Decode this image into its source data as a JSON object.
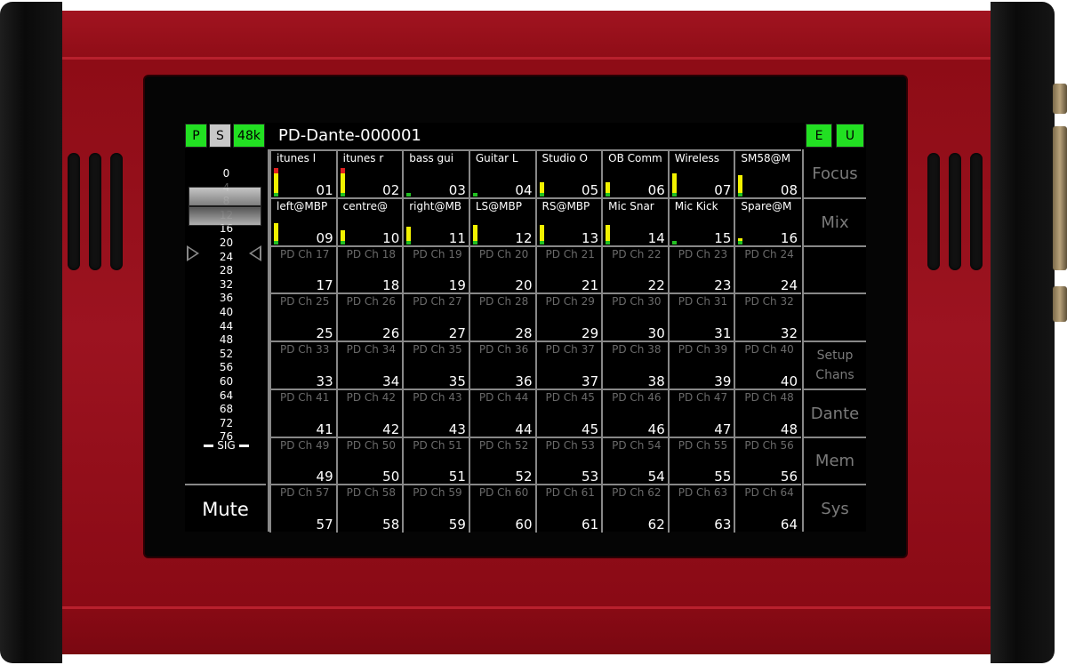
{
  "header": {
    "status": [
      {
        "label": "P",
        "on": true
      },
      {
        "label": "S",
        "on": false
      },
      {
        "label": "48k",
        "on": true
      }
    ],
    "device_name": "PD-Dante-000001",
    "modes": [
      {
        "label": "E",
        "on": true
      },
      {
        "label": "U",
        "on": true
      }
    ]
  },
  "level_scale": [
    "0",
    "4",
    "8",
    "12",
    "16",
    "20",
    "24",
    "28",
    "32",
    "36",
    "40",
    "44",
    "48",
    "52",
    "56",
    "60",
    "64",
    "68",
    "72",
    "76"
  ],
  "sig_label": "SIG",
  "mute_label": "Mute",
  "side_buttons": [
    {
      "label": "Focus"
    },
    {
      "label": "Mix"
    },
    {
      "label": ""
    },
    {
      "label": ""
    },
    {
      "label": "Setup Chans",
      "line1": "Setup",
      "line2": "Chans"
    },
    {
      "label": "Dante"
    },
    {
      "label": "Mem"
    },
    {
      "label": "Sys"
    }
  ],
  "channels": [
    {
      "name": "itunes l",
      "num": "01",
      "meter": {
        "green": 0.1,
        "yellow": 0.55,
        "red": 0.15
      }
    },
    {
      "name": "itunes r",
      "num": "02",
      "meter": {
        "green": 0.1,
        "yellow": 0.55,
        "red": 0.15
      }
    },
    {
      "name": "bass gui",
      "num": "03",
      "meter": {
        "green": 0.1,
        "yellow": 0,
        "red": 0
      }
    },
    {
      "name": "Guitar L",
      "num": "04",
      "meter": {
        "green": 0.1,
        "yellow": 0,
        "red": 0
      }
    },
    {
      "name": "Studio O",
      "num": "05",
      "meter": {
        "green": 0.1,
        "yellow": 0.3,
        "red": 0
      }
    },
    {
      "name": "OB Comm",
      "num": "06",
      "meter": {
        "green": 0.1,
        "yellow": 0.3,
        "red": 0
      }
    },
    {
      "name": "Wireless",
      "num": "07",
      "meter": {
        "green": 0.1,
        "yellow": 0.55,
        "red": 0
      }
    },
    {
      "name": "SM58@M",
      "num": "08",
      "meter": {
        "green": 0.1,
        "yellow": 0.5,
        "red": 0
      }
    },
    {
      "name": "left@MBP",
      "num": "09",
      "meter": {
        "green": 0.1,
        "yellow": 0.5,
        "red": 0
      }
    },
    {
      "name": "centre@",
      "num": "10",
      "meter": {
        "green": 0.1,
        "yellow": 0.3,
        "red": 0
      }
    },
    {
      "name": "right@MB",
      "num": "11",
      "meter": {
        "green": 0.1,
        "yellow": 0.4,
        "red": 0
      }
    },
    {
      "name": "LS@MBP",
      "num": "12",
      "meter": {
        "green": 0.1,
        "yellow": 0.45,
        "red": 0
      }
    },
    {
      "name": "RS@MBP",
      "num": "13",
      "meter": {
        "green": 0.1,
        "yellow": 0.45,
        "red": 0
      }
    },
    {
      "name": "Mic Snar",
      "num": "14",
      "meter": {
        "green": 0.1,
        "yellow": 0.45,
        "red": 0
      }
    },
    {
      "name": "Mic Kick",
      "num": "15",
      "meter": {
        "green": 0.1,
        "yellow": 0,
        "red": 0
      }
    },
    {
      "name": "Spare@M",
      "num": "16",
      "meter": {
        "green": 0.1,
        "yellow": 0.05,
        "red": 0
      }
    },
    {
      "name": "PD Ch 17",
      "num": "17"
    },
    {
      "name": "PD Ch 18",
      "num": "18"
    },
    {
      "name": "PD Ch 19",
      "num": "19"
    },
    {
      "name": "PD Ch 20",
      "num": "20"
    },
    {
      "name": "PD Ch 21",
      "num": "21"
    },
    {
      "name": "PD Ch 22",
      "num": "22"
    },
    {
      "name": "PD Ch 23",
      "num": "23"
    },
    {
      "name": "PD Ch 24",
      "num": "24"
    },
    {
      "name": "PD Ch 25",
      "num": "25"
    },
    {
      "name": "PD Ch 26",
      "num": "26"
    },
    {
      "name": "PD Ch 27",
      "num": "27"
    },
    {
      "name": "PD Ch 28",
      "num": "28"
    },
    {
      "name": "PD Ch 29",
      "num": "29"
    },
    {
      "name": "PD Ch 30",
      "num": "30"
    },
    {
      "name": "PD Ch 31",
      "num": "31"
    },
    {
      "name": "PD Ch 32",
      "num": "32"
    },
    {
      "name": "PD Ch 33",
      "num": "33"
    },
    {
      "name": "PD Ch 34",
      "num": "34"
    },
    {
      "name": "PD Ch 35",
      "num": "35"
    },
    {
      "name": "PD Ch 36",
      "num": "36"
    },
    {
      "name": "PD Ch 37",
      "num": "37"
    },
    {
      "name": "PD Ch 38",
      "num": "38"
    },
    {
      "name": "PD Ch 39",
      "num": "39"
    },
    {
      "name": "PD Ch 40",
      "num": "40"
    },
    {
      "name": "PD Ch 41",
      "num": "41"
    },
    {
      "name": "PD Ch 42",
      "num": "42"
    },
    {
      "name": "PD Ch 43",
      "num": "43"
    },
    {
      "name": "PD Ch 44",
      "num": "44"
    },
    {
      "name": "PD Ch 45",
      "num": "45"
    },
    {
      "name": "PD Ch 46",
      "num": "46"
    },
    {
      "name": "PD Ch 47",
      "num": "47"
    },
    {
      "name": "PD Ch 48",
      "num": "48"
    },
    {
      "name": "PD Ch 49",
      "num": "49"
    },
    {
      "name": "PD Ch 50",
      "num": "50"
    },
    {
      "name": "PD Ch 51",
      "num": "51"
    },
    {
      "name": "PD Ch 52",
      "num": "52"
    },
    {
      "name": "PD Ch 53",
      "num": "53"
    },
    {
      "name": "PD Ch 54",
      "num": "54"
    },
    {
      "name": "PD Ch 55",
      "num": "55"
    },
    {
      "name": "PD Ch 56",
      "num": "56"
    },
    {
      "name": "PD Ch 57",
      "num": "57"
    },
    {
      "name": "PD Ch 58",
      "num": "58"
    },
    {
      "name": "PD Ch 59",
      "num": "59"
    },
    {
      "name": "PD Ch 60",
      "num": "60"
    },
    {
      "name": "PD Ch 61",
      "num": "61"
    },
    {
      "name": "PD Ch 62",
      "num": "62"
    },
    {
      "name": "PD Ch 63",
      "num": "63"
    },
    {
      "name": "PD Ch 64",
      "num": "64"
    }
  ],
  "colors": {
    "chassis_red": "#9c1320",
    "indicator_on": "#22e022",
    "indicator_off": "#c8c8c8",
    "meter_green": "#22c022",
    "meter_yellow": "#f2f200",
    "meter_red": "#e02020",
    "idle_text": "#6a6a6a",
    "grid_line": "#888888"
  },
  "icons": [
    "fader-knob-icon",
    "left-pointer-icon",
    "right-pointer-icon",
    "sig-indicator-icon"
  ]
}
